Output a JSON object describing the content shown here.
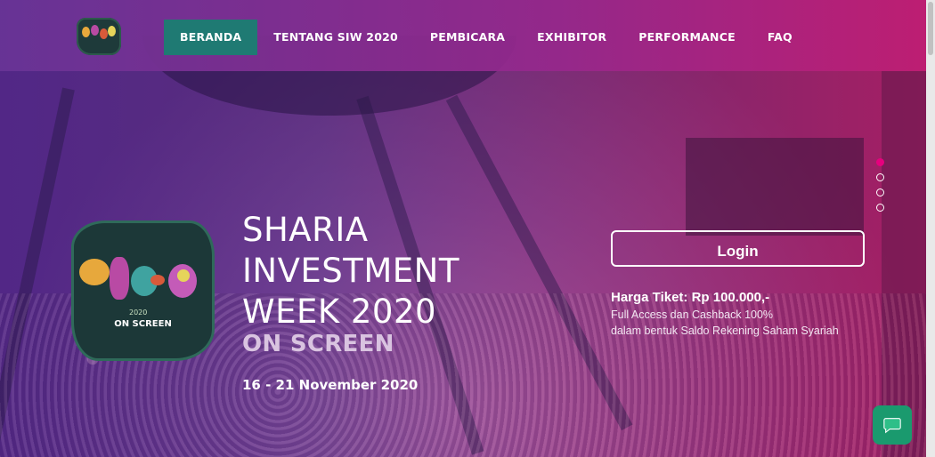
{
  "nav": {
    "items": [
      {
        "label": "BERANDA",
        "active": true
      },
      {
        "label": "TENTANG SIW 2020",
        "active": false
      },
      {
        "label": "PEMBICARA",
        "active": false
      },
      {
        "label": "EXHIBITOR",
        "active": false
      },
      {
        "label": "PERFORMANCE",
        "active": false
      },
      {
        "label": "FAQ",
        "active": false
      }
    ]
  },
  "hero": {
    "logo_year": "2020",
    "logo_caption": "ON SCREEN",
    "title_line1": "SHARIA",
    "title_line2": "INVESTMENT",
    "title_line3": "WEEK 2020",
    "subtitle": "ON SCREEN",
    "dates": "16 - 21 November 2020",
    "background_screen_text": "SHARIA INVESTMENT WEEK"
  },
  "login": {
    "label": "Login"
  },
  "ticket": {
    "price": "Harga Tiket: Rp 100.000,-",
    "line1": "Full Access dan Cashback 100%",
    "line2": "dalam bentuk Saldo Rekening Saham Syariah"
  },
  "slider": {
    "count": 4,
    "active_index": 0
  },
  "colors": {
    "active_nav": "#1f7a73",
    "active_dot": "#e6007e",
    "chat_button": "#1a9a6e"
  },
  "icons": {
    "chat": "chat-bubble-icon"
  }
}
